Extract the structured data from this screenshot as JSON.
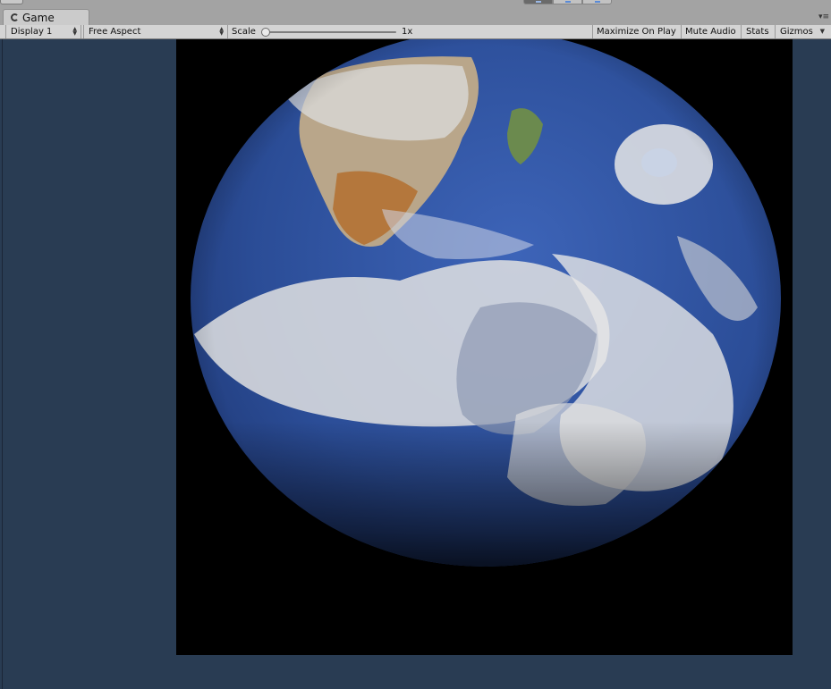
{
  "window": {
    "tab_label": "Game"
  },
  "toolbar": {
    "display": "Display 1",
    "aspect": "Free Aspect",
    "scale_label": "Scale",
    "scale_value": "1x",
    "maximize_on_play": "Maximize On Play",
    "mute_audio": "Mute Audio",
    "stats": "Stats",
    "gizmos": "Gizmos"
  },
  "icons": {
    "tab_icon": "game-controller-icon",
    "updown": "updown-arrows-icon",
    "dropdown": "chevron-down-icon",
    "menu": "tab-menu-icon"
  },
  "colors": {
    "viewport_background": "#293c53",
    "game_background": "#000000",
    "toolbar": "#d4d4d4",
    "ocean": "#2c4f9a"
  }
}
